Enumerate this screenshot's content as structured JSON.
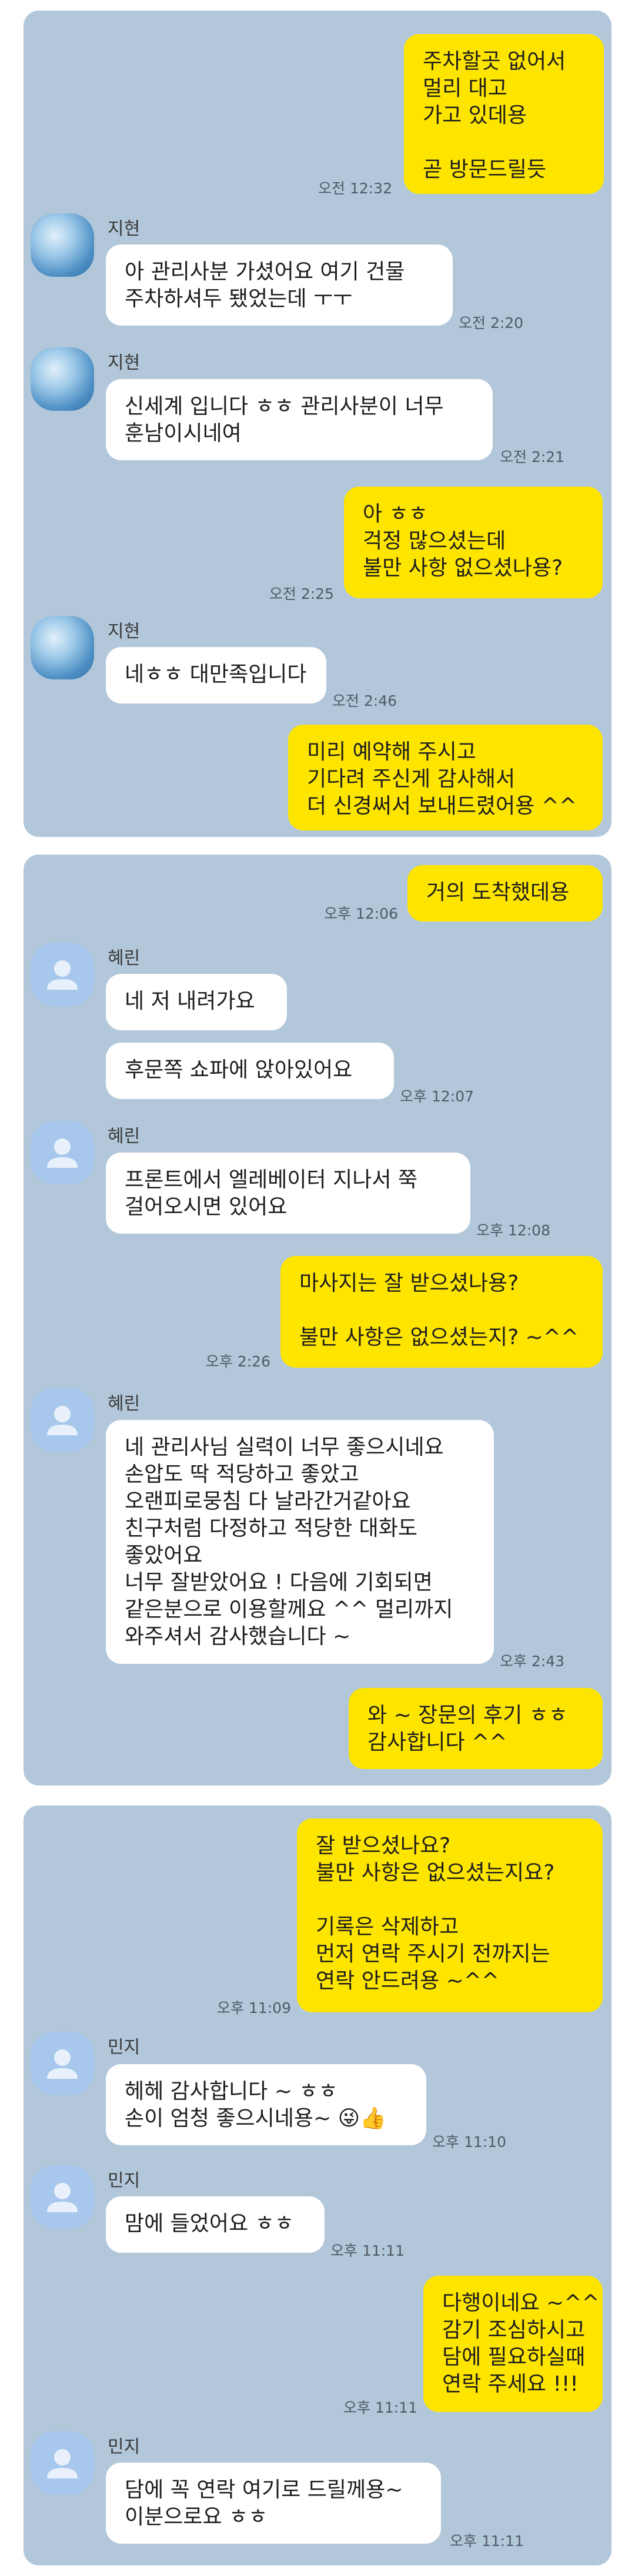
{
  "panels": [
    {
      "messages": [
        {
          "from": "me",
          "text": "주차할곳 없어서\n멀리 대고\n가고 있데용\n\n곧 방문드릴듯",
          "time": "오전 12:32"
        },
        {
          "from": "other",
          "name": "지현",
          "text": "아 관리사분 가셨어요 여기 건물\n주차하셔두 됐었는데 ㅜㅜ",
          "time": "오전 2:20"
        },
        {
          "from": "other",
          "name": "지현",
          "text": "신세계 입니다 ㅎㅎ 관리사분이 너무\n훈남이시네여",
          "time": "오전 2:21"
        },
        {
          "from": "me",
          "text": "아 ㅎㅎ\n걱정 많으셨는데\n불만 사항 없으셨나용?",
          "time": "오전 2:25"
        },
        {
          "from": "other",
          "name": "지현",
          "text": "네ㅎㅎ 대만족입니다",
          "time": "오전 2:46"
        },
        {
          "from": "me",
          "text": "미리 예약해 주시고\n기다려 주신게 감사해서\n더 신경써서 보내드렸어용 ^^",
          "time": ""
        }
      ]
    },
    {
      "messages": [
        {
          "from": "me",
          "text": "거의 도착했데용",
          "time": "오후 12:06"
        },
        {
          "from": "other",
          "name": "혜린",
          "text": "네 저 내려가요",
          "time": ""
        },
        {
          "from": "other",
          "name": "",
          "text": "후문쪽 쇼파에 앉아있어요",
          "time": "오후 12:07"
        },
        {
          "from": "other",
          "name": "혜린",
          "text": "프론트에서 엘레베이터 지나서 쭉\n걸어오시면 있어요",
          "time": "오후 12:08"
        },
        {
          "from": "me",
          "text": "마사지는 잘 받으셨나용?\n\n불만 사항은 없으셨는지? ~^^",
          "time": "오후 2:26"
        },
        {
          "from": "other",
          "name": "혜린",
          "text": "네 관리사님 실력이 너무 좋으시네요\n손압도 딱 적당하고 좋았고\n오랜피로뭉침 다 날라간거같아요\n친구처럼 다정하고 적당한 대화도\n좋았어요\n너무 잘받았어요 ! 다음에 기회되면\n같은분으로 이용할께요 ^^ 멀리까지\n와주셔서 감사했습니다 ~",
          "time": "오후 2:43"
        },
        {
          "from": "me",
          "text": "와 ~ 장문의 후기 ㅎㅎ\n감사합니다 ^^",
          "time": ""
        }
      ]
    },
    {
      "messages": [
        {
          "from": "me",
          "text": "잘 받으셨나요?\n불만 사항은 없으셨는지요?\n\n기록은 삭제하고\n먼저 연락 주시기 전까지는\n연락 안드려용 ~^^",
          "time": "오후 11:09"
        },
        {
          "from": "other",
          "name": "민지",
          "text": "헤헤 감사합니다 ~ ㅎㅎ\n손이 엄청 좋으시네용~ 😜👍",
          "time": "오후 11:10"
        },
        {
          "from": "other",
          "name": "민지",
          "text": "맘에 들었어요 ㅎㅎ",
          "time": "오후 11:11"
        },
        {
          "from": "me",
          "text": "다행이네요 ~^^\n감기 조심하시고\n담에 필요하실때\n연락 주세요 !!!",
          "time": "오후 11:11"
        },
        {
          "from": "other",
          "name": "민지",
          "text": "담에 꼭 연락 여기로 드릴께용~\n이분으로요 ㅎㅎ",
          "time": "오후 11:11"
        }
      ]
    }
  ]
}
